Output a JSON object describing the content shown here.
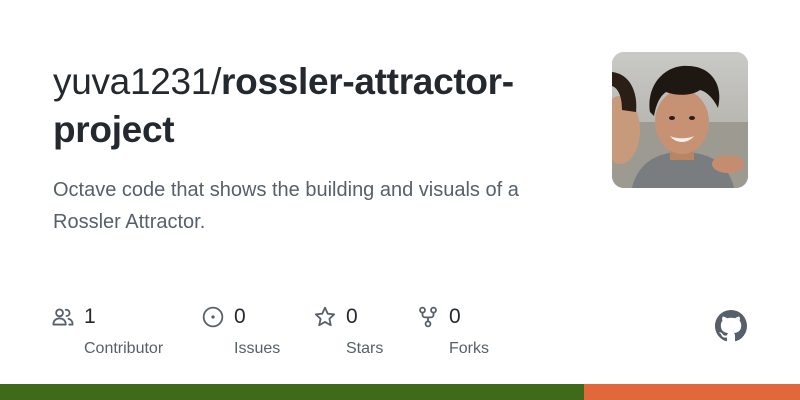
{
  "repo": {
    "owner_prefix": "yuva1231/",
    "name": "rossler-attractor-project",
    "description": "Octave code that shows the building and visuals of a Rossler Attractor."
  },
  "stats": {
    "contributors": {
      "count": "1",
      "label": "Contributor",
      "icon": "people-icon"
    },
    "issues": {
      "count": "0",
      "label": "Issues",
      "icon": "issue-opened-icon"
    },
    "stars": {
      "count": "0",
      "label": "Stars",
      "icon": "star-icon"
    },
    "forks": {
      "count": "0",
      "label": "Forks",
      "icon": "repo-forked-icon"
    }
  },
  "brand": {
    "icon": "github-mark-icon",
    "color": "#57606a"
  },
  "language_bar": [
    {
      "color": "#3f6a1a",
      "fraction": 0.73
    },
    {
      "color": "#e0683b",
      "fraction": 0.27
    }
  ],
  "colors": {
    "text_primary": "#24292f",
    "text_secondary": "#57606a",
    "background": "#ffffff"
  }
}
